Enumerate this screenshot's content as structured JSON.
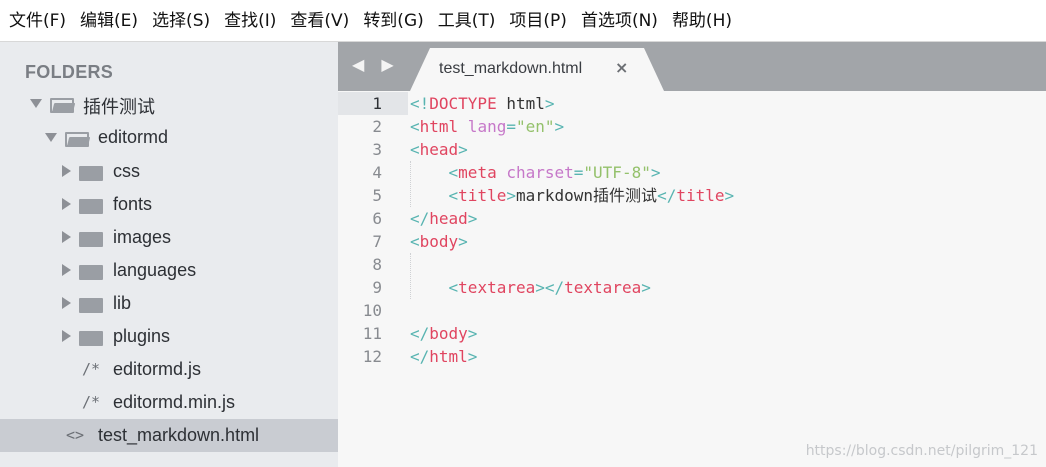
{
  "menubar": {
    "items": [
      "文件(F)",
      "编辑(E)",
      "选择(S)",
      "查找(I)",
      "查看(V)",
      "转到(G)",
      "工具(T)",
      "项目(P)",
      "首选项(N)",
      "帮助(H)"
    ]
  },
  "sidebar": {
    "header": "FOLDERS",
    "root_folder": "插件测试",
    "project_folder": "editormd",
    "folders": [
      "css",
      "fonts",
      "images",
      "languages",
      "lib",
      "plugins"
    ],
    "files": [
      {
        "icon": "/*",
        "name": "editormd.js"
      },
      {
        "icon": "/*",
        "name": "editormd.min.js"
      }
    ],
    "open_file": {
      "icon": "<>",
      "name": "test_markdown.html"
    }
  },
  "editor": {
    "nav_arrows": "◀ ▶",
    "tab": {
      "title": "test_markdown.html",
      "close": "×"
    },
    "line_numbers": [
      "1",
      "2",
      "3",
      "4",
      "5",
      "6",
      "7",
      "8",
      "9",
      "10",
      "11",
      "12"
    ],
    "active_line": 1,
    "code": {
      "l1_open": "<!",
      "l1_doctype": "DOCTYPE",
      "l1_html": " html",
      "l1_close": ">",
      "l2_open": "<",
      "l2_tag": "html",
      "l2_attr": " lang",
      "l2_eq": "=",
      "l2_str": "\"en\"",
      "l2_close": ">",
      "l3_open": "<",
      "l3_tag": "head",
      "l3_close": ">",
      "l4_indent": "    ",
      "l4_open": "<",
      "l4_tag": "meta",
      "l4_attr": " charset",
      "l4_eq": "=",
      "l4_str": "\"UTF-8\"",
      "l4_close": ">",
      "l5_indent": "    ",
      "l5_open": "<",
      "l5_tag": "title",
      "l5_close": ">",
      "l5_text": "markdown插件测试",
      "l5_open2": "</",
      "l5_tag2": "title",
      "l5_close2": ">",
      "l6_open": "</",
      "l6_tag": "head",
      "l6_close": ">",
      "l7_open": "<",
      "l7_tag": "body",
      "l7_close": ">",
      "l9_indent": "    ",
      "l9_open": "<",
      "l9_tag": "textarea",
      "l9_close": "></",
      "l9_tag2": "textarea",
      "l9_close2": ">",
      "l11_open": "</",
      "l11_tag": "body",
      "l11_close": ">",
      "l12_open": "</",
      "l12_tag": "html",
      "l12_close": ">"
    }
  },
  "watermark": "https://blog.csdn.net/pilgrim_121",
  "colors": {
    "tag": "#e04560",
    "punctuation": "#58b4b1",
    "attribute": "#c678c9",
    "string": "#94c16b",
    "sidebar_bg": "#e9ebee",
    "tabbar_bg": "#a2a5a9"
  }
}
